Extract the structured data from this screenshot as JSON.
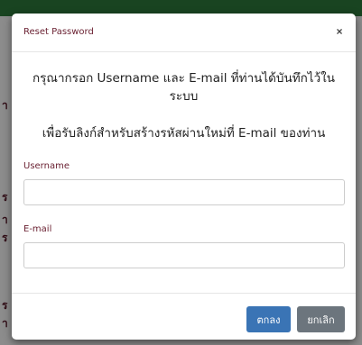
{
  "colors": {
    "header_bar": "#2e7d3d",
    "label_text": "#6b2233",
    "primary_button": "#3a74b5",
    "secondary_button": "#6c757d"
  },
  "background": {
    "side_fragments": [
      "า",
      "ร",
      "า",
      "ร",
      "ร",
      "า"
    ]
  },
  "modal": {
    "title": "Reset Password",
    "close_icon": "×",
    "instruction_line1": "กรุณากรอก Username และ E-mail ที่ท่านได้บันทึกไว้ในระบบ",
    "instruction_line2": "เพื่อรับลิงก์สำหรับสร้างรหัสผ่านใหม่ที่ E-mail ของท่าน",
    "username_label": "Username",
    "username_value": "",
    "email_label": "E-mail",
    "email_value": "",
    "ok_label": "ตกลง",
    "cancel_label": "ยกเลิก"
  }
}
